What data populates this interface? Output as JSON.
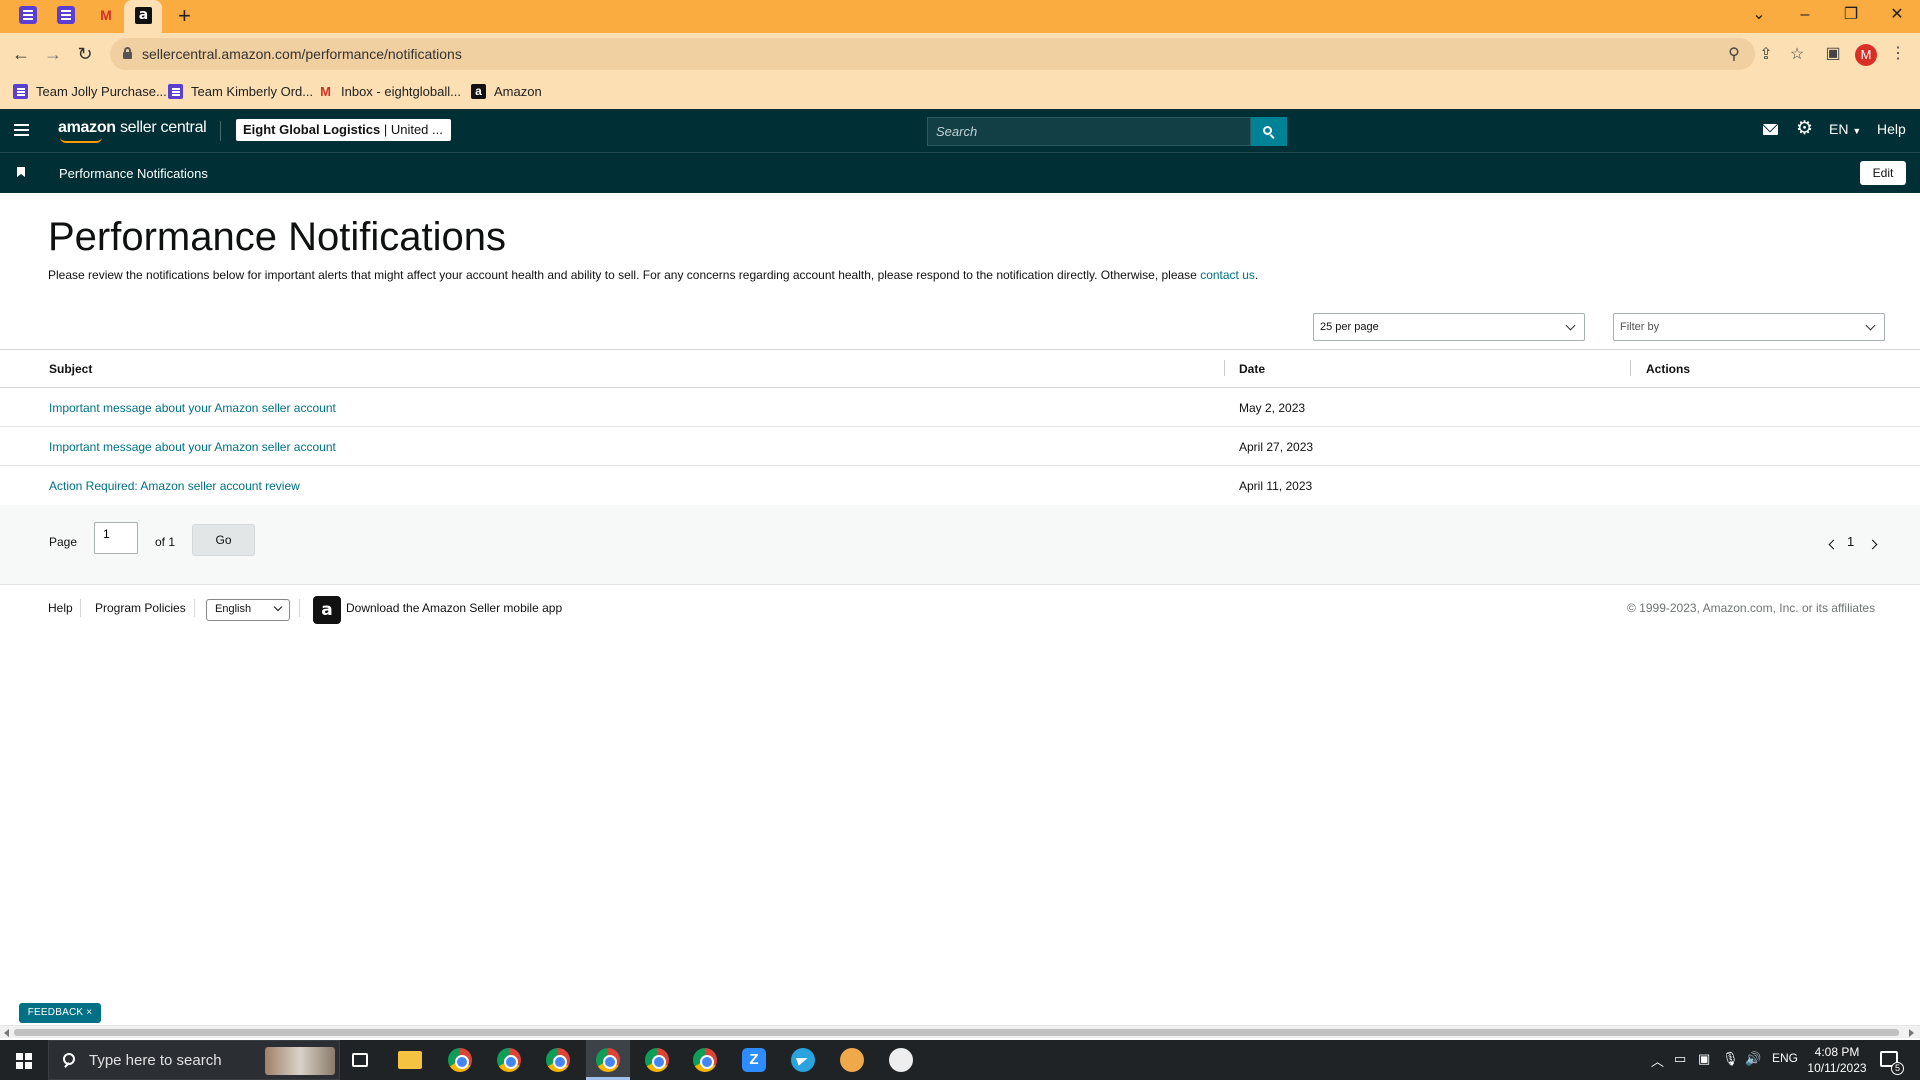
{
  "browser": {
    "url": "sellercentral.amazon.com/performance/notifications",
    "profile_initial": "M",
    "bookmarks": [
      {
        "label": "Team Jolly Purchase..."
      },
      {
        "label": "Team Kimberly Ord..."
      },
      {
        "label": "Inbox - eightgloball..."
      },
      {
        "label": "Amazon"
      }
    ]
  },
  "header": {
    "logo_brand": "amazon",
    "logo_product": "seller central",
    "account_bold": "Eight Global Logistics",
    "account_rest": " | United ...",
    "search_placeholder": "Search",
    "language": "EN",
    "help": "Help"
  },
  "subnav": {
    "title": "Performance Notifications",
    "edit_label": "Edit"
  },
  "main": {
    "title": "Performance Notifications",
    "intro_text": "Please review the notifications below for important alerts that might affect your account health and ability to sell. For any concerns regarding account health, please respond to the notification directly. Otherwise, please ",
    "intro_link": "contact us",
    "intro_end": ".",
    "per_page": "25 per page",
    "filter_placeholder": "Filter by",
    "columns": {
      "subject": "Subject",
      "date": "Date",
      "actions": "Actions"
    },
    "rows": [
      {
        "subject": "Important message about your Amazon seller account",
        "date": "May 2, 2023"
      },
      {
        "subject": "Important message about your Amazon seller account",
        "date": "April 27, 2023"
      },
      {
        "subject": "Action Required: Amazon seller account review",
        "date": "April 11, 2023"
      }
    ],
    "pagination": {
      "page_label": "Page",
      "page_value": "1",
      "of_label": "of 1",
      "go_label": "Go",
      "current_page": "1"
    }
  },
  "footer": {
    "help": "Help",
    "program_policies": "Program Policies",
    "language": "English",
    "app_text": "Download the Amazon Seller mobile app",
    "copyright": "© 1999-2023, Amazon.com, Inc. or its affiliates"
  },
  "feedback_label": "FEEDBACK ×",
  "taskbar": {
    "search_placeholder": "Type here to search",
    "language": "ENG",
    "time": "4:08 PM",
    "date": "10/11/2023",
    "notification_count": "5"
  },
  "colors": {
    "tab_strip": "#fbac40",
    "header": "#002f36",
    "link": "#007185",
    "search_button": "#008296",
    "logo_smile": "#ff9900"
  }
}
